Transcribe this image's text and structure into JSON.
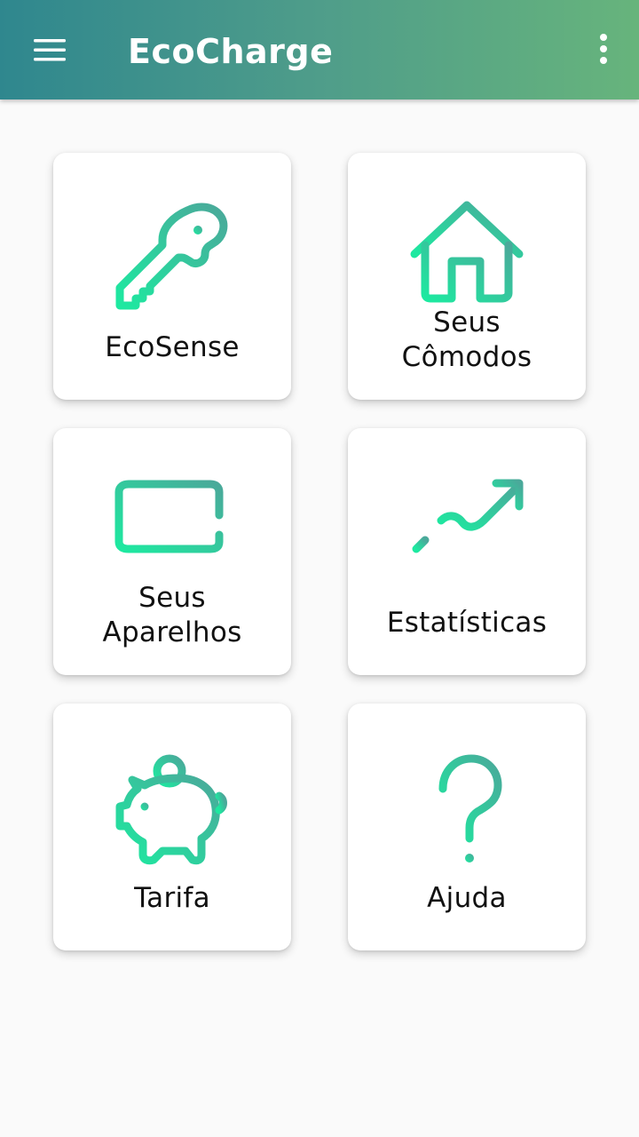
{
  "app": {
    "title": "EcoCharge"
  },
  "icons": {
    "menu": "hamburger-menu-icon",
    "overflow": "more-vertical-icon"
  },
  "colors": {
    "appbar_gradient_start": "#2f878e",
    "appbar_gradient_end": "#67b47c",
    "icon_gradient_start": "#1de9a0",
    "icon_gradient_end": "#4aa99a",
    "background": "#fafafa",
    "card": "#ffffff"
  },
  "menu": {
    "items": [
      {
        "label": "EcoSense",
        "icon": "key-icon"
      },
      {
        "label": "Seus\nCômodos",
        "icon": "house-icon"
      },
      {
        "label": "Seus\nAparelhos",
        "icon": "monitor-icon"
      },
      {
        "label": "Estatísticas",
        "icon": "growth-chart-icon"
      },
      {
        "label": "Tarifa",
        "icon": "piggy-bank-icon"
      },
      {
        "label": "Ajuda",
        "icon": "question-mark-icon"
      }
    ]
  }
}
